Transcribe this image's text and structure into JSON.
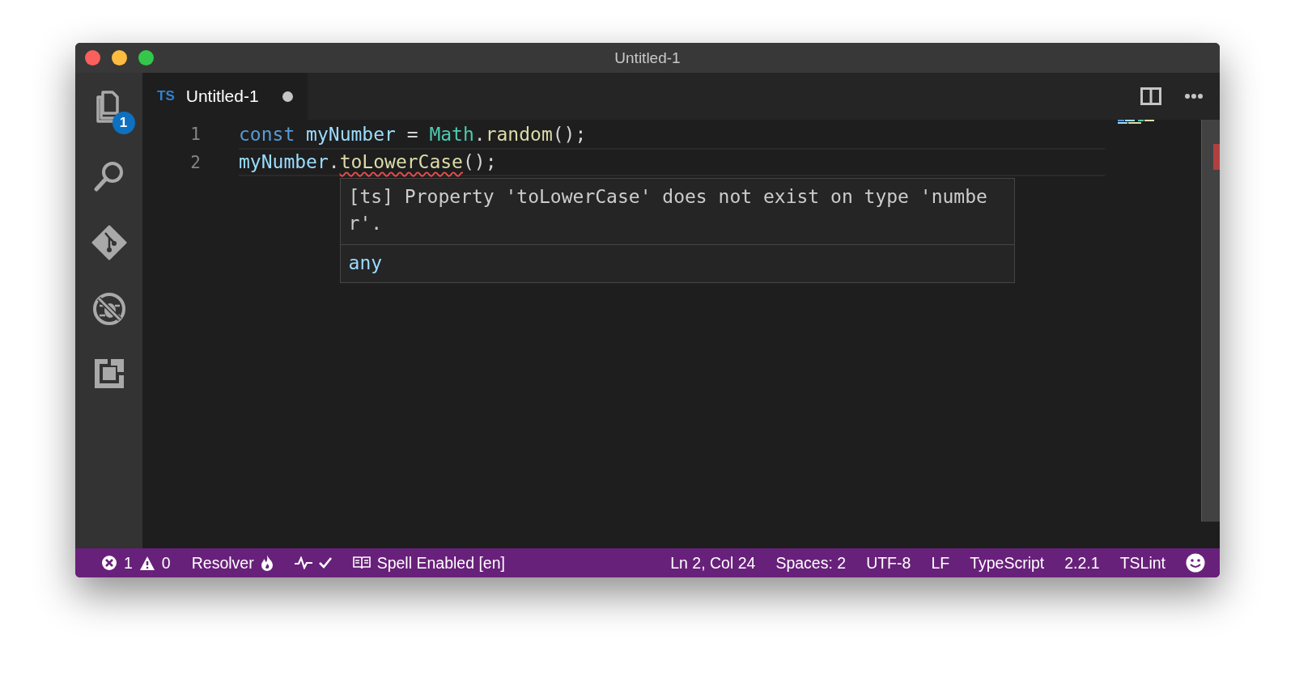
{
  "window": {
    "title": "Untitled-1"
  },
  "activity_bar": {
    "items": [
      {
        "kind": "files",
        "badge": "1"
      },
      {
        "kind": "search"
      },
      {
        "kind": "git"
      },
      {
        "kind": "debug"
      },
      {
        "kind": "extensions"
      }
    ]
  },
  "tabs": [
    {
      "file_type": "TS",
      "label": "Untitled-1",
      "dirty": true,
      "selected": true
    }
  ],
  "editor": {
    "lines": [
      {
        "number": "1",
        "current": false,
        "tokens": [
          {
            "text": "const ",
            "kind": "keyword"
          },
          {
            "text": "myNumber",
            "kind": "variable"
          },
          {
            "text": " = ",
            "kind": "plain"
          },
          {
            "text": "Math",
            "kind": "type"
          },
          {
            "text": ".",
            "kind": "plain"
          },
          {
            "text": "random",
            "kind": "function"
          },
          {
            "text": "();",
            "kind": "plain"
          }
        ]
      },
      {
        "number": "2",
        "current": true,
        "tokens": [
          {
            "text": "myNumber",
            "kind": "variable"
          },
          {
            "text": ".",
            "kind": "plain"
          },
          {
            "text": "toLowerCase",
            "kind": "function",
            "error": true
          },
          {
            "text": "();",
            "kind": "plain"
          }
        ]
      }
    ],
    "hover": {
      "message": "[ts] Property 'toLowerCase' does not exist on type 'number'.",
      "type": "any"
    }
  },
  "status_bar": {
    "errors": "1",
    "warnings": "0",
    "left_items": [
      {
        "label": "Resolver",
        "kind": "flame"
      },
      {
        "kind": "pulse-check"
      },
      {
        "label": "Spell Enabled [en]",
        "kind": "book"
      }
    ],
    "right_items": [
      {
        "label": "Ln 2, Col 24"
      },
      {
        "label": "Spaces: 2"
      },
      {
        "label": "UTF-8"
      },
      {
        "label": "LF"
      },
      {
        "label": "TypeScript"
      },
      {
        "label": "2.2.1"
      },
      {
        "label": "TSLint"
      },
      {
        "kind": "smiley"
      }
    ]
  }
}
